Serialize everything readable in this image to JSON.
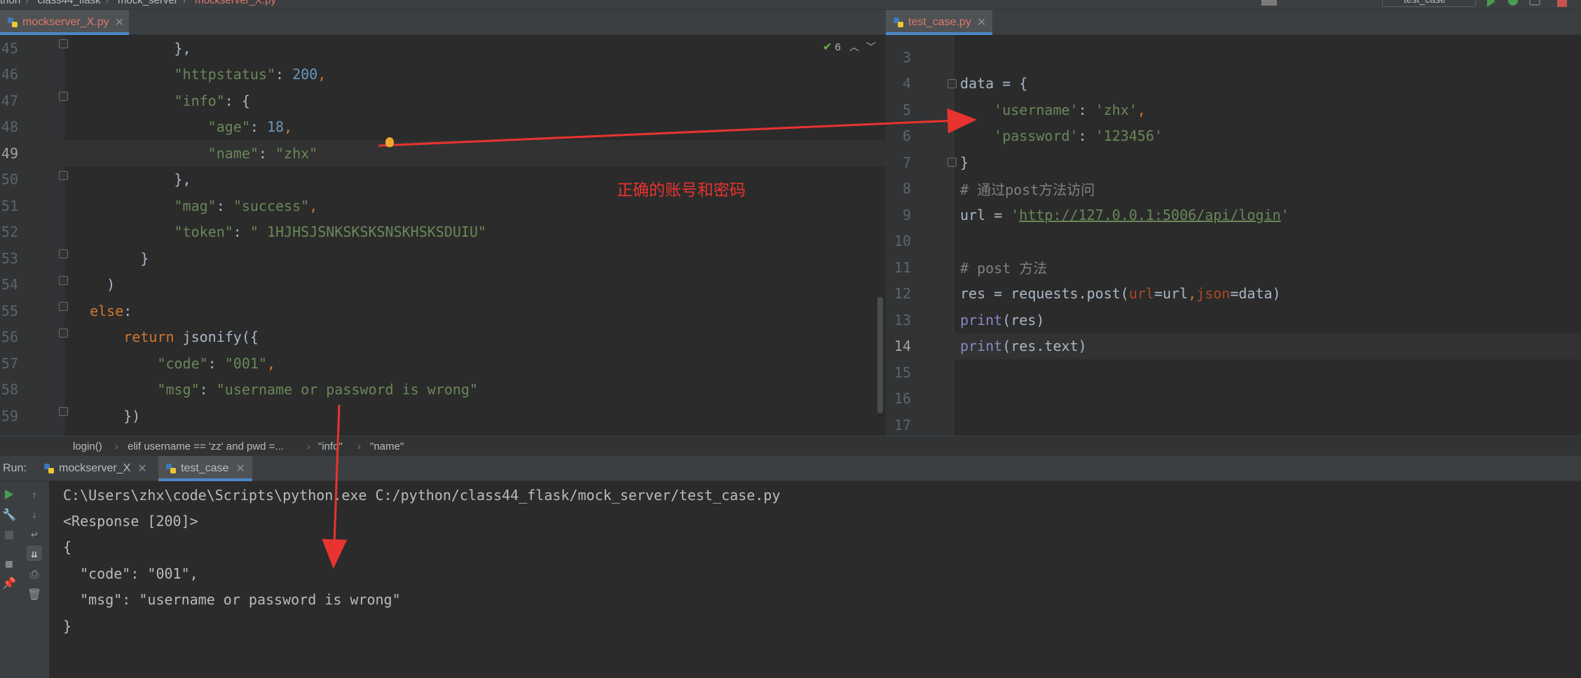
{
  "navbar": {
    "crumbs": [
      "thon",
      "class44_flask",
      "mock_server",
      "mockserver_X.py"
    ],
    "run_config": "test_case"
  },
  "tabs": {
    "left": [
      {
        "label": "mockserver_X.py",
        "active": true
      }
    ],
    "right": [
      {
        "label": "test_case.py",
        "active": true
      }
    ]
  },
  "inspection": {
    "count": "6"
  },
  "left_editor": {
    "current_line": "49",
    "lines": [
      {
        "n": "45",
        "code": "            },",
        "tokens": [
          [
            "            },",
            ""
          ]
        ]
      },
      {
        "n": "46",
        "tokens": [
          [
            "            ",
            ""
          ],
          [
            "\"httpstatus\"",
            "str"
          ],
          [
            ": ",
            ""
          ],
          [
            "200",
            "num"
          ],
          [
            ",",
            "kw"
          ]
        ]
      },
      {
        "n": "47",
        "tokens": [
          [
            "            ",
            ""
          ],
          [
            "\"info\"",
            "str"
          ],
          [
            ": {",
            ""
          ]
        ]
      },
      {
        "n": "48",
        "tokens": [
          [
            "                ",
            ""
          ],
          [
            "\"age\"",
            "str"
          ],
          [
            ": ",
            ""
          ],
          [
            "18",
            "num"
          ],
          [
            ",",
            "kw"
          ]
        ]
      },
      {
        "n": "49",
        "tokens": [
          [
            "                ",
            ""
          ],
          [
            "\"name\"",
            "str"
          ],
          [
            ": ",
            ""
          ],
          [
            "\"zhx\"",
            "str"
          ]
        ]
      },
      {
        "n": "50",
        "tokens": [
          [
            "            },",
            ""
          ]
        ]
      },
      {
        "n": "51",
        "tokens": [
          [
            "            ",
            ""
          ],
          [
            "\"mag\"",
            "str"
          ],
          [
            ": ",
            ""
          ],
          [
            "\"success\"",
            "str"
          ],
          [
            ",",
            "kw"
          ]
        ]
      },
      {
        "n": "52",
        "tokens": [
          [
            "            ",
            ""
          ],
          [
            "\"token\"",
            "str"
          ],
          [
            ": ",
            ""
          ],
          [
            "\" 1HJHSJSNKSKSKSNSKHSKSDUIU\"",
            "str"
          ]
        ]
      },
      {
        "n": "53",
        "tokens": [
          [
            "        }",
            ""
          ]
        ]
      },
      {
        "n": "54",
        "tokens": [
          [
            "    )",
            ""
          ]
        ]
      },
      {
        "n": "55",
        "tokens": [
          [
            "  ",
            ""
          ],
          [
            "else",
            "kw"
          ],
          [
            ":",
            ""
          ]
        ]
      },
      {
        "n": "56",
        "tokens": [
          [
            "      ",
            ""
          ],
          [
            "return",
            "kw"
          ],
          [
            " jsonify({",
            ""
          ]
        ]
      },
      {
        "n": "57",
        "tokens": [
          [
            "          ",
            ""
          ],
          [
            "\"code\"",
            "str"
          ],
          [
            ": ",
            ""
          ],
          [
            "\"001\"",
            "str"
          ],
          [
            ",",
            "kw"
          ]
        ]
      },
      {
        "n": "58",
        "tokens": [
          [
            "          ",
            ""
          ],
          [
            "\"msg\"",
            "str"
          ],
          [
            ": ",
            ""
          ],
          [
            "\"username or password is wrong\"",
            "str"
          ]
        ]
      },
      {
        "n": "59",
        "tokens": [
          [
            "      })",
            ""
          ]
        ]
      }
    ]
  },
  "right_editor": {
    "current_line": "14",
    "lines": [
      {
        "n": "3",
        "tokens": []
      },
      {
        "n": "4",
        "tokens": [
          [
            "data = {",
            ""
          ]
        ]
      },
      {
        "n": "5",
        "tokens": [
          [
            "    ",
            ""
          ],
          [
            "'username'",
            "str"
          ],
          [
            ": ",
            ""
          ],
          [
            "'zhx'",
            "str"
          ],
          [
            ",",
            "kw"
          ]
        ]
      },
      {
        "n": "6",
        "tokens": [
          [
            "    ",
            ""
          ],
          [
            "'password'",
            "str"
          ],
          [
            ": ",
            ""
          ],
          [
            "'123456'",
            "str"
          ]
        ]
      },
      {
        "n": "7",
        "tokens": [
          [
            "}",
            ""
          ]
        ]
      },
      {
        "n": "8",
        "tokens": [
          [
            "# 通过post方法访问",
            "cmt"
          ]
        ]
      },
      {
        "n": "9",
        "tokens": [
          [
            "url = ",
            ""
          ],
          [
            "'",
            "str"
          ],
          [
            "http://127.0.0.1:5006/api/login",
            "link"
          ],
          [
            "'",
            "str"
          ]
        ]
      },
      {
        "n": "10",
        "tokens": []
      },
      {
        "n": "11",
        "tokens": [
          [
            "# post 方法",
            "cmt"
          ]
        ]
      },
      {
        "n": "12",
        "tokens": [
          [
            "res = requests.post(",
            ""
          ],
          [
            "url",
            "kwarg"
          ],
          [
            "=url",
            ""
          ],
          [
            ",",
            "kw"
          ],
          [
            "json",
            "kwarg"
          ],
          [
            "=data)",
            ""
          ]
        ]
      },
      {
        "n": "13",
        "tokens": [
          [
            "print",
            "bi"
          ],
          [
            "(res)",
            ""
          ]
        ]
      },
      {
        "n": "14",
        "tokens": [
          [
            "print",
            "bi"
          ],
          [
            "(res.text)",
            ""
          ]
        ]
      },
      {
        "n": "15",
        "tokens": []
      },
      {
        "n": "16",
        "tokens": []
      },
      {
        "n": "17",
        "tokens": []
      }
    ]
  },
  "breadcrumb": [
    "login()",
    "elif username == 'zz' and pwd =...",
    "\"info\"",
    "\"name\""
  ],
  "run_panel": {
    "label": "Run:",
    "tabs": [
      {
        "label": "mockserver_X",
        "active": false
      },
      {
        "label": "test_case",
        "active": true
      }
    ],
    "console_lines": [
      "C:\\Users\\zhx\\code\\Scripts\\python.exe C:/python/class44_flask/mock_server/test_case.py",
      "<Response [200]>",
      "{",
      "  \"code\": \"001\",",
      "  \"msg\": \"username or password is wrong\"",
      "}"
    ]
  },
  "annotation": {
    "text": "正确的账号和密码",
    "color": "#e8332f"
  },
  "colors": {
    "accent": "#4a88c7",
    "arrow": "#e8332f",
    "bulb": "#f0a732"
  }
}
